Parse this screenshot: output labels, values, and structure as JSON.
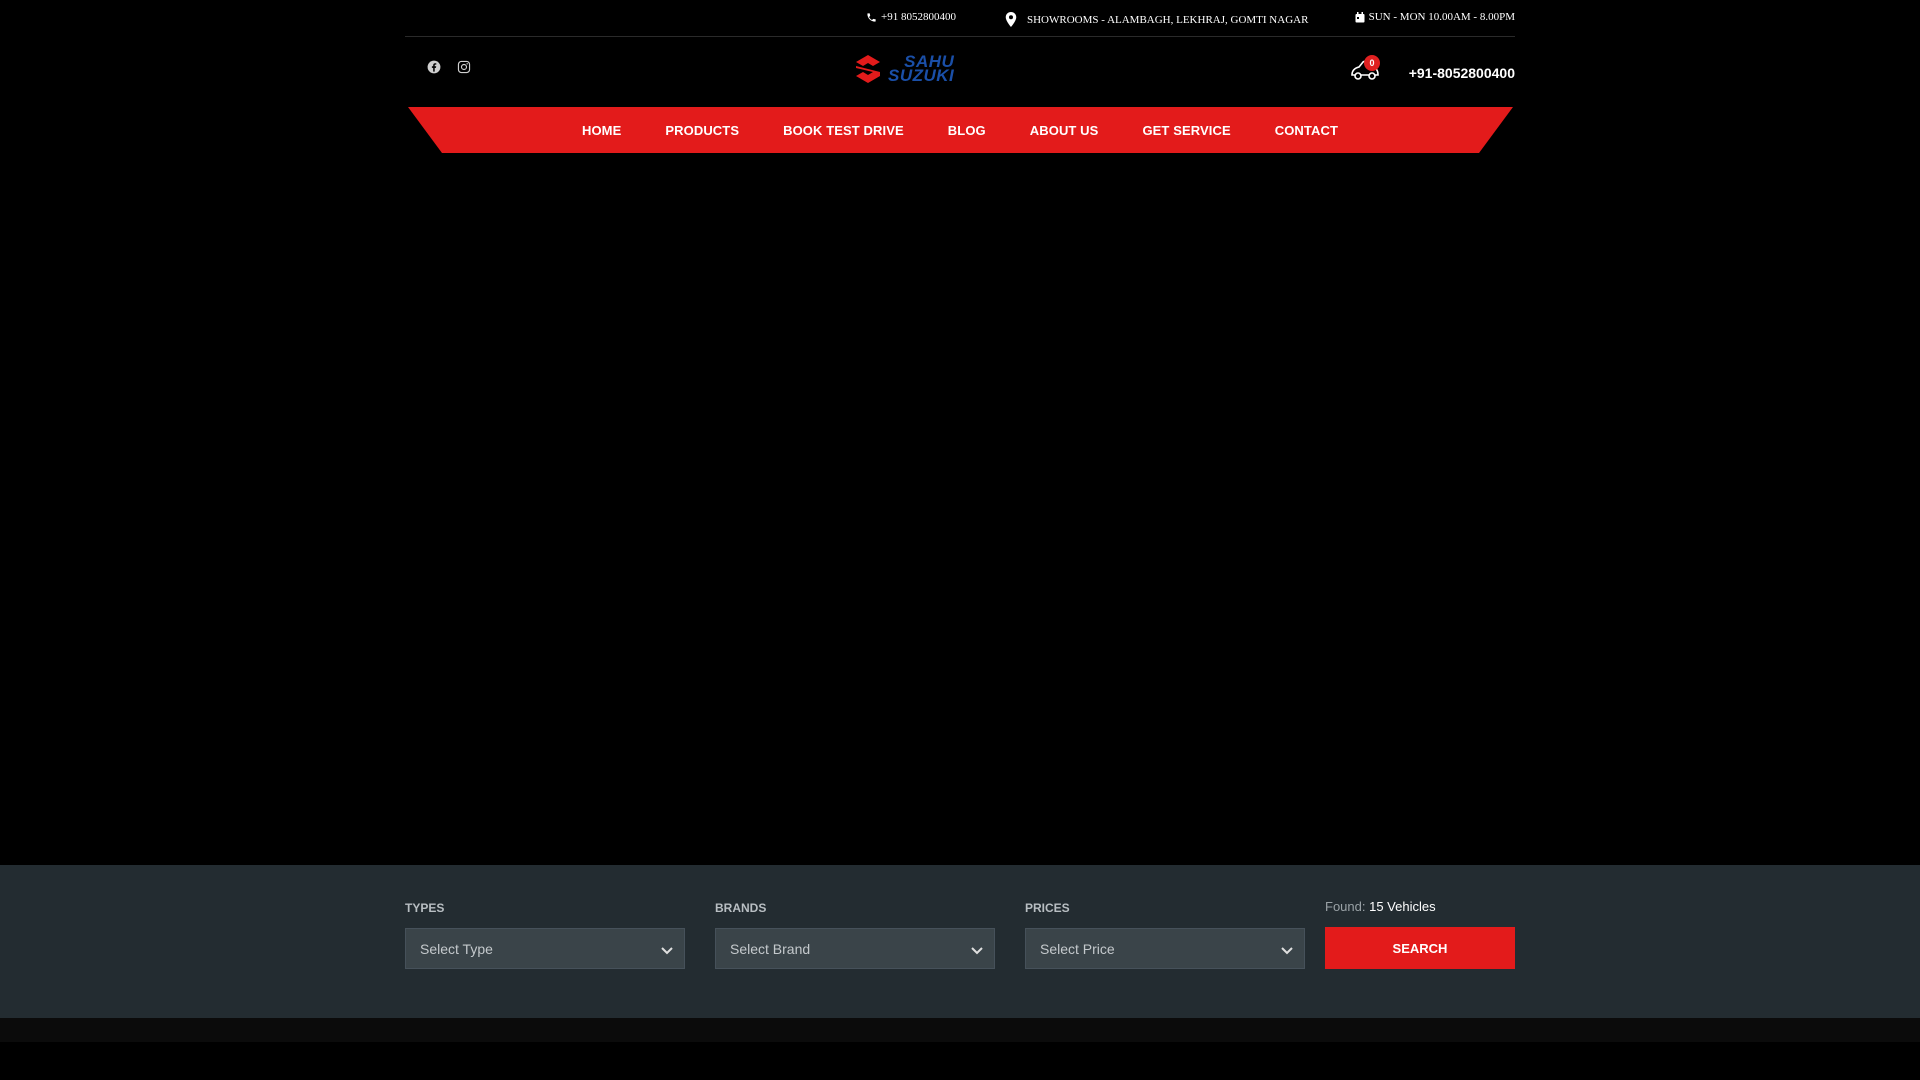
{
  "topbar": {
    "phone": "+91 8052800400",
    "address": "SHOWROOMS - ALAMBAGH, LEKHRAJ, GOMTI NAGAR",
    "hours": "SUN - MON 10.00AM - 8.00PM"
  },
  "header": {
    "logo_line1": "SAHU",
    "logo_line2": "SUZUKI",
    "cart_count": "0",
    "phone": "+91-8052800400"
  },
  "nav": {
    "items": [
      {
        "label": "HOME"
      },
      {
        "label": "PRODUCTS"
      },
      {
        "label": "BOOK TEST DRIVE"
      },
      {
        "label": "BLOG"
      },
      {
        "label": "ABOUT US"
      },
      {
        "label": "GET SERVICE"
      },
      {
        "label": "CONTACT"
      }
    ]
  },
  "search": {
    "types_label": "TYPES",
    "types_value": "Select Type",
    "brands_label": "BRANDS",
    "brands_value": "Select Brand",
    "prices_label": "PRICES",
    "prices_value": "Select Price",
    "found_label": "Found:",
    "found_count": "15 Vehicles",
    "button_label": "SEARCH"
  },
  "colors": {
    "brand_red": "#e31b1b",
    "logo_blue": "#1a4fa8",
    "panel_bg": "#232c31"
  }
}
